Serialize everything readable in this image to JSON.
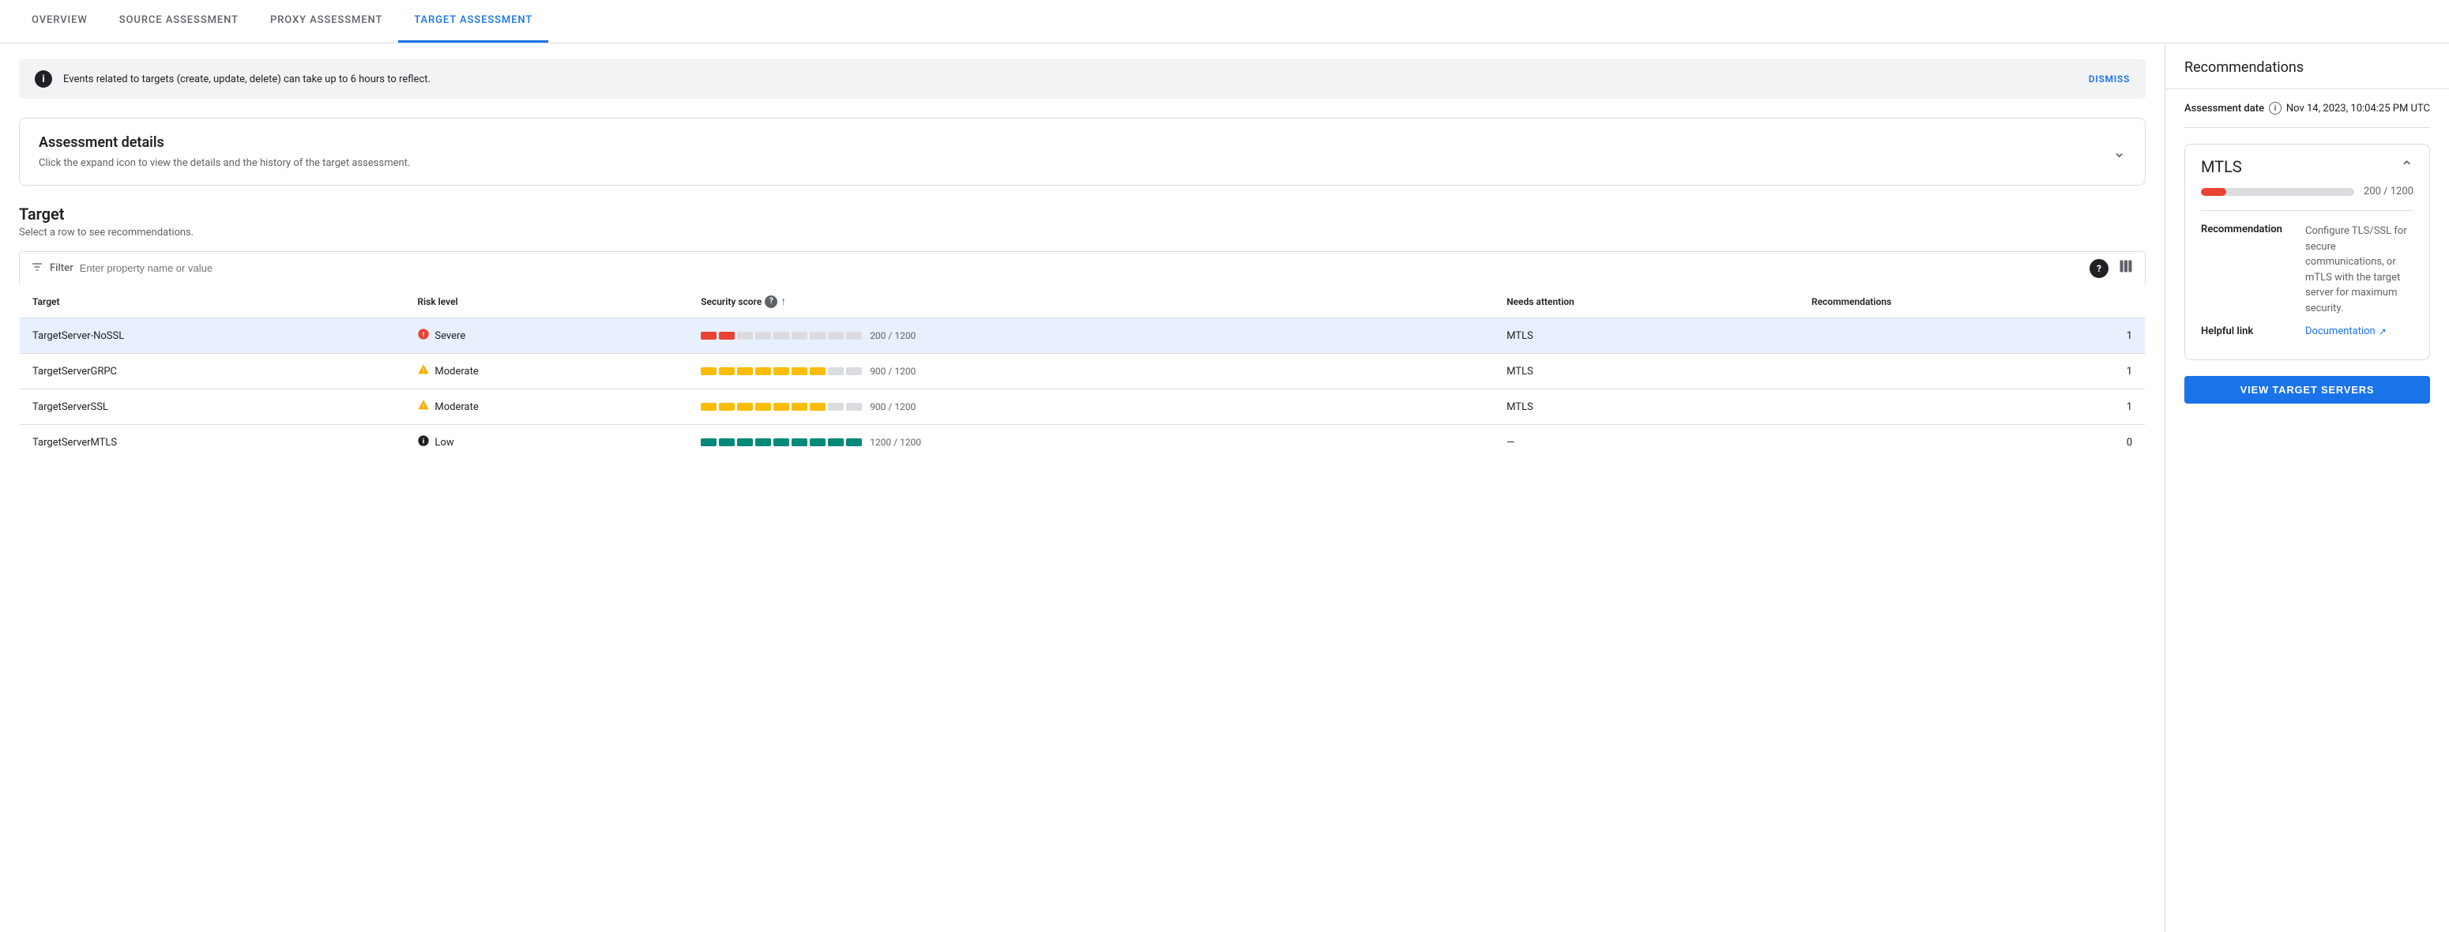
{
  "nav": {
    "tabs": [
      {
        "id": "overview",
        "label": "OVERVIEW",
        "active": false
      },
      {
        "id": "source",
        "label": "SOURCE ASSESSMENT",
        "active": false
      },
      {
        "id": "proxy",
        "label": "PROXY ASSESSMENT",
        "active": false
      },
      {
        "id": "target",
        "label": "TARGET ASSESSMENT",
        "active": true
      }
    ]
  },
  "alert": {
    "message": "Events related to targets (create, update, delete) can take up to 6 hours to reflect.",
    "dismiss_label": "DISMISS"
  },
  "assessment_details": {
    "title": "Assessment details",
    "subtitle": "Click the expand icon to view the details and the history of the target assessment."
  },
  "target_section": {
    "title": "Target",
    "subtitle": "Select a row to see recommendations.",
    "filter_placeholder": "Enter property name or value",
    "filter_label": "Filter"
  },
  "table": {
    "columns": [
      {
        "id": "target",
        "label": "Target"
      },
      {
        "id": "risk",
        "label": "Risk level"
      },
      {
        "id": "score",
        "label": "Security score",
        "has_help": true,
        "has_sort": true
      },
      {
        "id": "attention",
        "label": "Needs attention"
      },
      {
        "id": "recommendations",
        "label": "Recommendations"
      }
    ],
    "rows": [
      {
        "target": "TargetServer-NoSSL",
        "risk": "Severe",
        "risk_type": "severe",
        "score_current": 200,
        "score_max": 1200,
        "score_display": "200 / 1200",
        "attention": "MTLS",
        "recommendations": "1",
        "selected": true
      },
      {
        "target": "TargetServerGRPC",
        "risk": "Moderate",
        "risk_type": "moderate",
        "score_current": 900,
        "score_max": 1200,
        "score_display": "900 / 1200",
        "attention": "MTLS",
        "recommendations": "1",
        "selected": false
      },
      {
        "target": "TargetServerSSL",
        "risk": "Moderate",
        "risk_type": "moderate",
        "score_current": 900,
        "score_max": 1200,
        "score_display": "900 / 1200",
        "attention": "MTLS",
        "recommendations": "1",
        "selected": false
      },
      {
        "target": "TargetServerMTLS",
        "risk": "Low",
        "risk_type": "low",
        "score_current": 1200,
        "score_max": 1200,
        "score_display": "1200 / 1200",
        "attention": "—",
        "recommendations": "0",
        "selected": false
      }
    ]
  },
  "sidebar": {
    "title": "Recommendations",
    "assessment_date_label": "Assessment date",
    "assessment_date_value": "Nov 14, 2023, 10:04:25 PM UTC",
    "mtls": {
      "title": "MTLS",
      "score_display": "200 / 1200",
      "score_percent": 16.7,
      "recommendation_label": "Recommendation",
      "recommendation_value": "Configure TLS/SSL for secure communications, or mTLS with the target server for maximum security.",
      "helpful_link_label": "Helpful link",
      "helpful_link_text": "Documentation",
      "helpful_link_url": "#"
    },
    "view_button_label": "VIEW TARGET SERVERS"
  },
  "colors": {
    "severe": "#ea4335",
    "moderate": "#f9ab00",
    "low": "#00897b",
    "blue": "#1a73e8"
  }
}
